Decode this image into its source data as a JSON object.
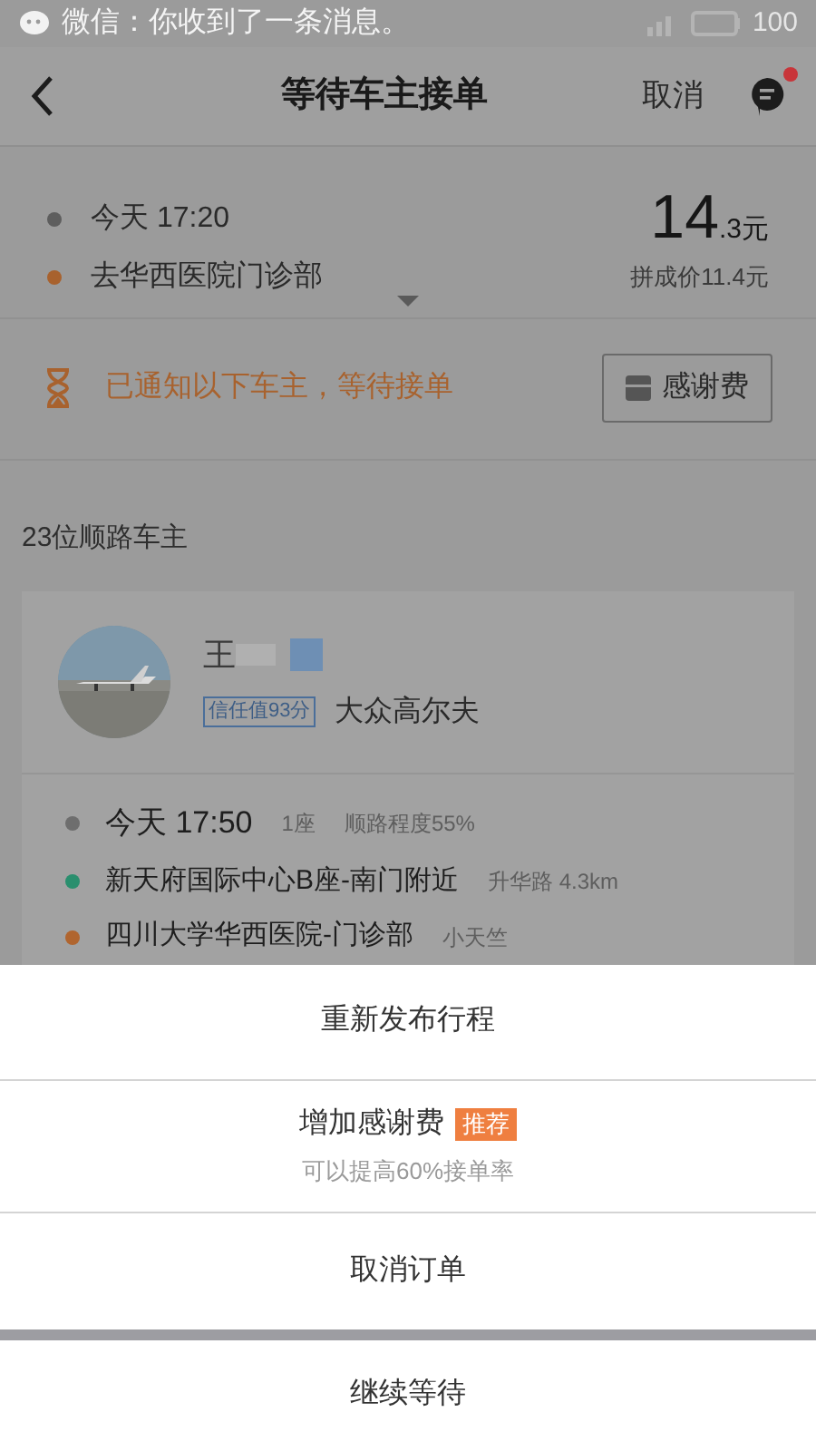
{
  "status_bar": {
    "notification": "微信：你收到了一条消息。",
    "battery": "100"
  },
  "header": {
    "title": "等待车主接单",
    "cancel": "取消",
    "has_unread": true
  },
  "trip": {
    "time": "今天 17:20",
    "destination": "去华西医院门诊部",
    "price_main": "14",
    "price_decimal": ".3元",
    "carpool_price": "拼成价11.4元"
  },
  "notice": {
    "text": "已通知以下车主，等待接单",
    "button": "感谢费"
  },
  "drivers": {
    "count": "23位顺路车主",
    "card": {
      "name": "王",
      "trust": "信任值93分",
      "car": "大众高尔夫",
      "rows": [
        {
          "kind": "time",
          "color": "#6e6e6e",
          "text": "今天 17:50",
          "extra": [
            "1座",
            "顺路程度55%"
          ]
        },
        {
          "kind": "place",
          "color": "#2a8f6e",
          "text": "新天府国际中心B座-南门附近",
          "extra": [
            "升华路 4.3km"
          ]
        },
        {
          "kind": "place",
          "color": "#b0652f",
          "text": "四川大学华西医院-门诊部",
          "extra": [
            "小天竺"
          ]
        }
      ]
    }
  },
  "sheet": {
    "items": [
      {
        "label": "重新发布行程"
      },
      {
        "label": "增加感谢费",
        "badge": "推荐",
        "subtitle": "可以提高60%接单率"
      },
      {
        "label": "取消订单"
      }
    ],
    "secondary": "继续等待"
  }
}
